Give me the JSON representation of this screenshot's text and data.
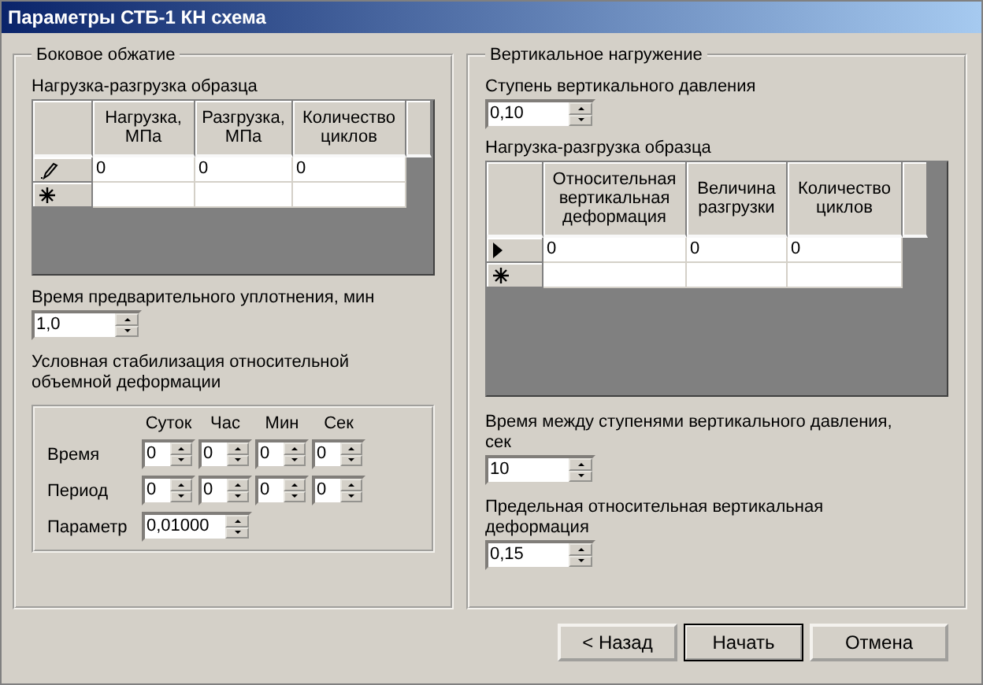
{
  "window": {
    "title": "Параметры СТБ-1 КН схема"
  },
  "lateral": {
    "title": "Боковое обжатие",
    "grid": {
      "label": "Нагрузка-разгрузка образца",
      "columns": [
        "Нагрузка, МПа",
        "Разгрузка, МПа",
        "Количество циклов"
      ],
      "rows": [
        {
          "kind": "editing",
          "cells": [
            "0",
            "0",
            "0"
          ]
        },
        {
          "kind": "new"
        }
      ]
    },
    "precompaction": {
      "label": "Время предварительного уплотнения, мин",
      "value": "1,0"
    },
    "stabilization": {
      "label": "Условная стабилизация относительной объемной деформации",
      "units": [
        "Суток",
        "Час",
        "Мин",
        "Сек"
      ],
      "rows": [
        {
          "label": "Время",
          "values": [
            "0",
            "0",
            "0",
            "0"
          ]
        },
        {
          "label": "Период",
          "values": [
            "0",
            "0",
            "0",
            "0"
          ]
        }
      ],
      "parameter": {
        "label": "Параметр",
        "value": "0,01000"
      }
    }
  },
  "vertical": {
    "title": "Вертикальное нагружение",
    "step": {
      "label": "Ступень вертикального давления",
      "value": "0,10"
    },
    "grid": {
      "label": "Нагрузка-разгрузка образца",
      "columns": [
        "Относительная вертикальная деформация",
        "Величина разгрузки",
        "Количество циклов"
      ],
      "rows": [
        {
          "kind": "current",
          "cells": [
            "0",
            "0",
            "0"
          ]
        },
        {
          "kind": "new"
        }
      ]
    },
    "interval": {
      "label": "Время между ступенями вертикального давления, сек",
      "value": "10"
    },
    "limit": {
      "label": "Предельная относительная вертикальная деформация",
      "value": "0,15"
    }
  },
  "buttons": [
    {
      "label": "< Назад",
      "default": false
    },
    {
      "label": "Начать",
      "default": true
    },
    {
      "label": "Отмена",
      "default": false
    }
  ]
}
